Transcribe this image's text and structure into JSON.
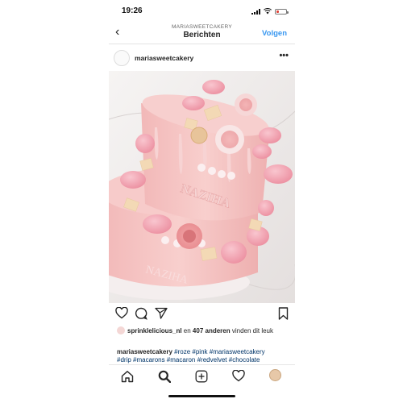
{
  "status_bar": {
    "time": "19:26",
    "battery_level": 0.2,
    "battery_color": "#e0453a"
  },
  "nav": {
    "back_icon": "chevron-left-icon",
    "subtitle": "MARIASWEETCAKERY",
    "title": "Berichten",
    "follow_label": "Volgen",
    "follow_color": "#3897f0"
  },
  "post": {
    "avatar_icon": "profile-avatar",
    "username": "mariasweetcakery",
    "more_icon": "more-dots-icon",
    "more_label": "•••",
    "image": "pink-drip-cake-with-macarons-and-roses",
    "cake_text": "NAZIHA",
    "actions": [
      "heart-icon",
      "comment-icon",
      "share-icon",
      "bookmark-icon"
    ],
    "likes": {
      "user": "sprinklelicious_nl",
      "middle": " en ",
      "count_text": "407 anderen",
      "suffix": " vinden dit leuk"
    },
    "caption": {
      "author": "mariasweetcakery",
      "hashtags_line1": " #roze #pink #mariasweetcakery",
      "hashtags_line2": "#drip #macarons #macaron #redvelvet #chocolate"
    }
  },
  "tab_bar": {
    "tabs": [
      "home-icon",
      "search-icon",
      "new-post-icon",
      "activity-heart-icon",
      "profile-avatar-icon"
    ]
  }
}
